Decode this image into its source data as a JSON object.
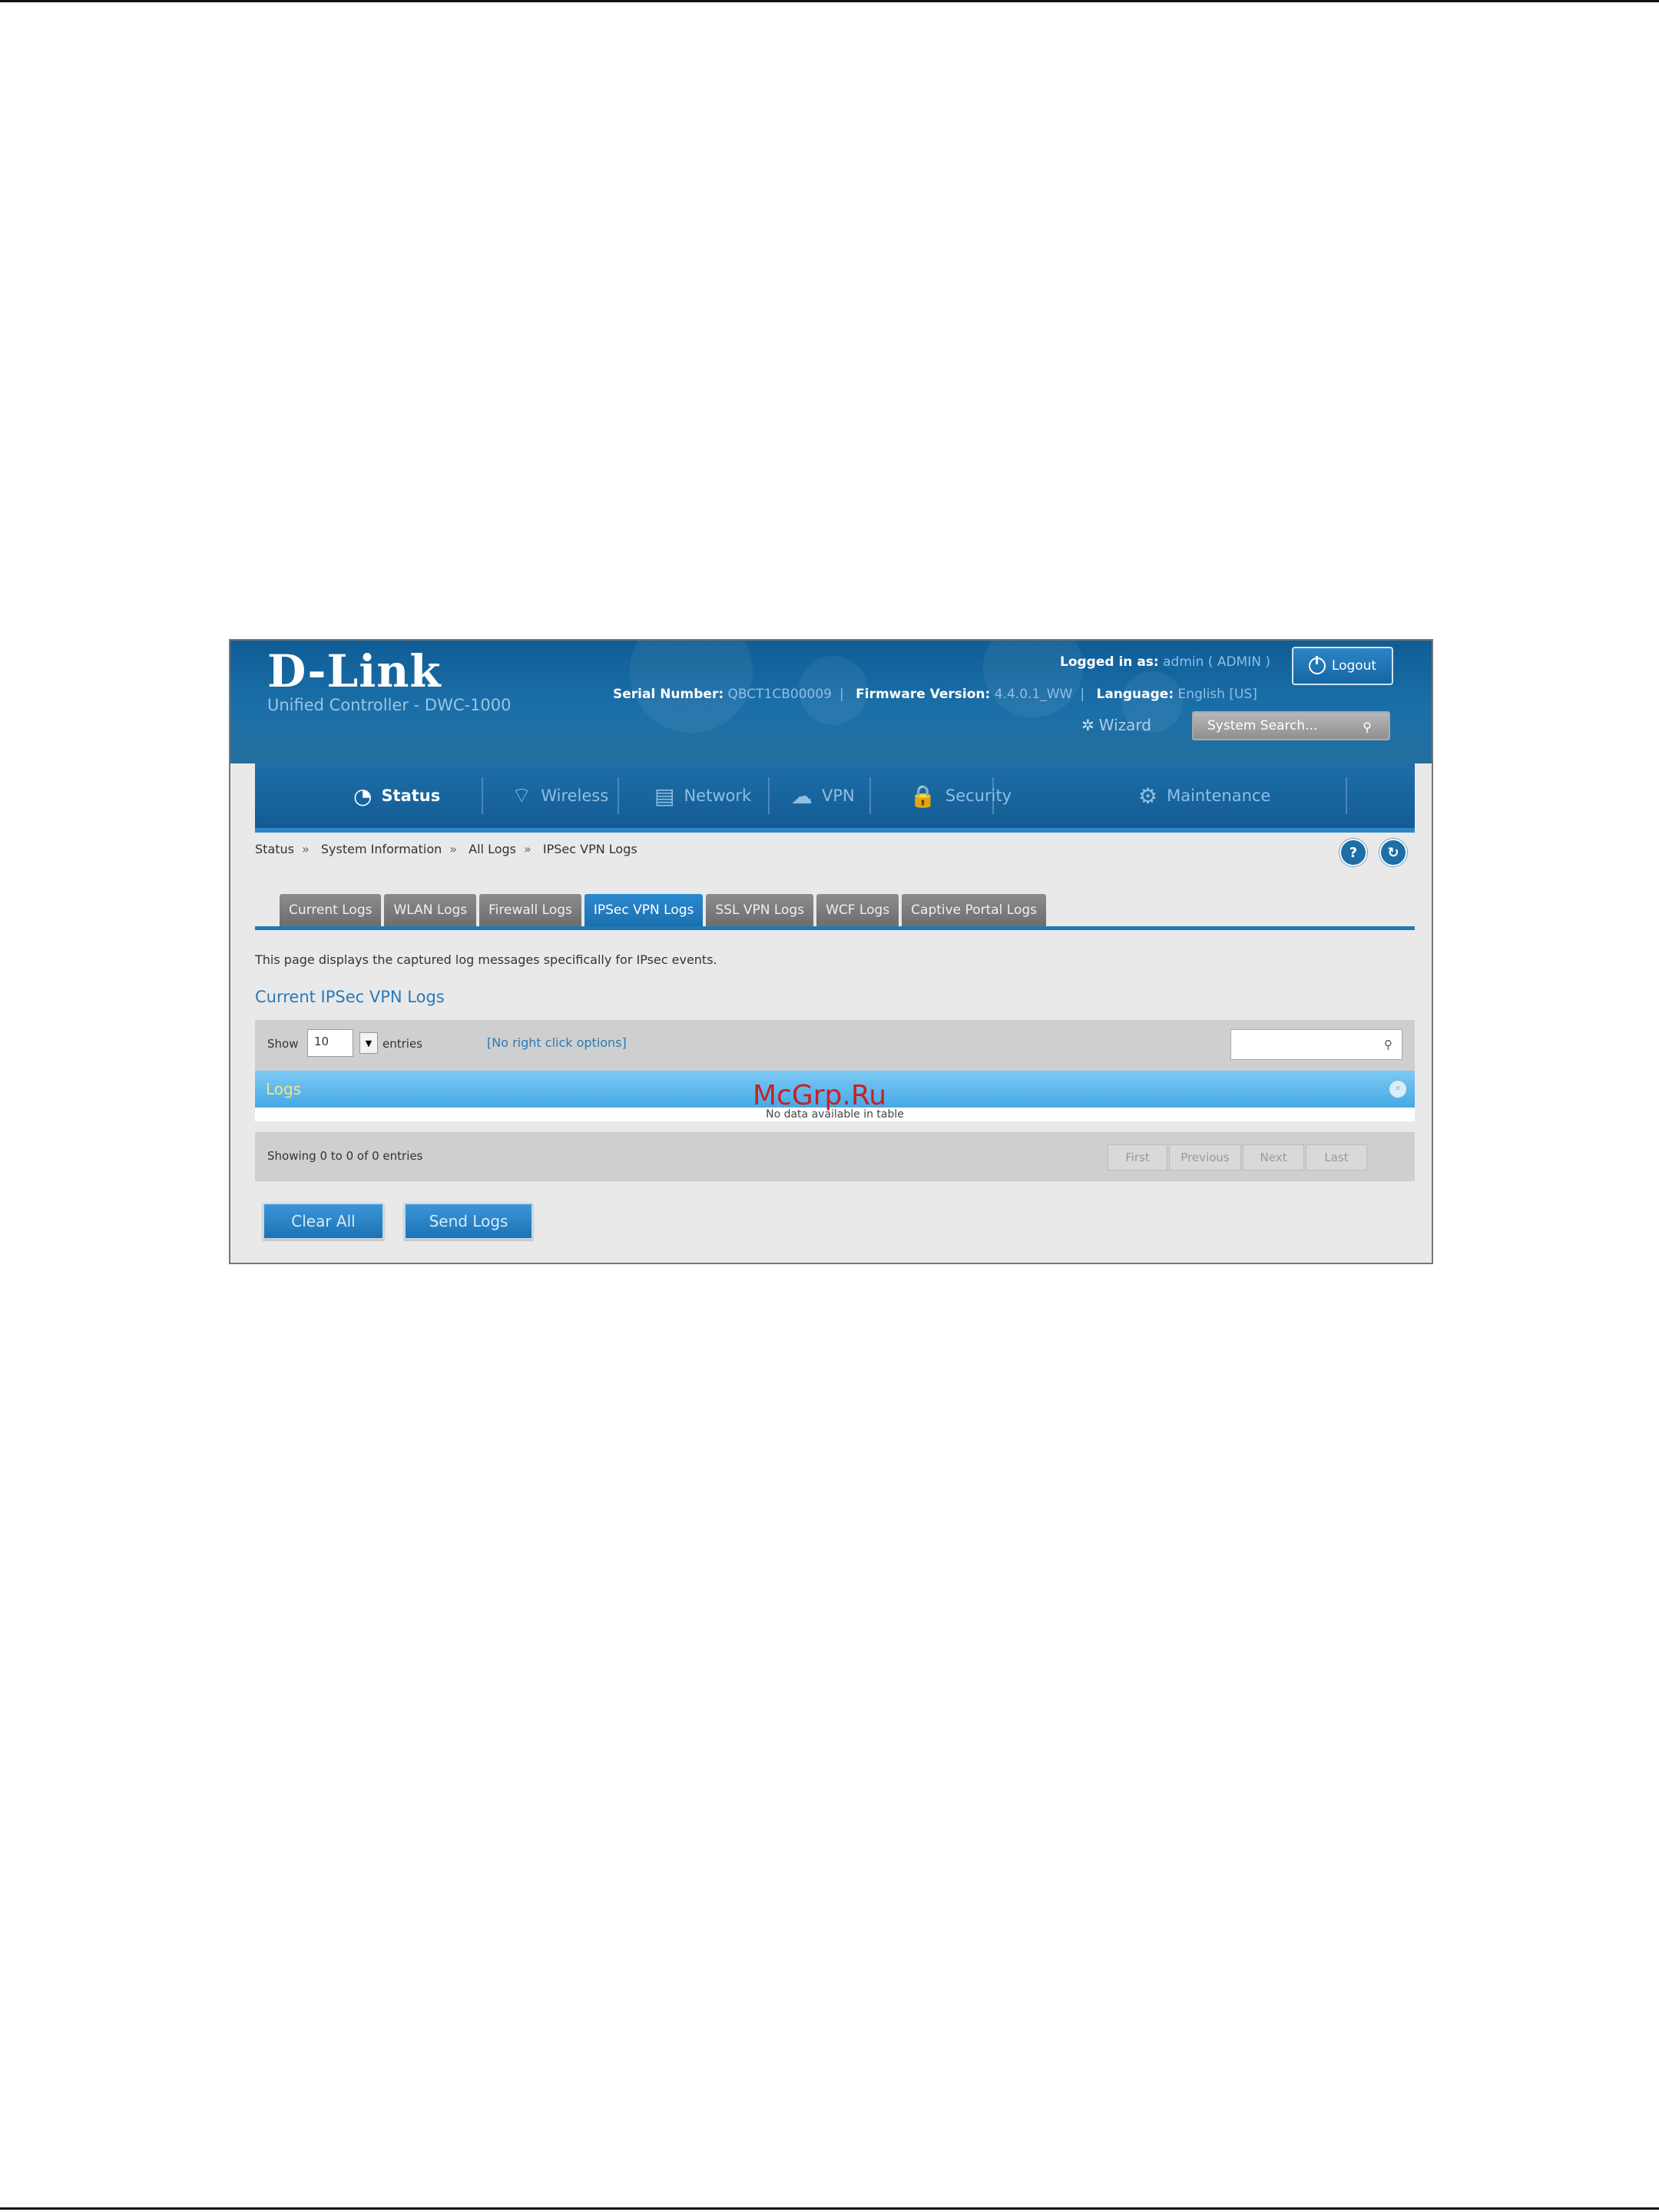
{
  "header": {
    "logo": "D-Link",
    "subtitle": "Unified Controller - DWC-1000",
    "logged_in_label": "Logged in as:",
    "logged_in_value": "admin ( ADMIN )",
    "logout_label": "Logout",
    "serial_label": "Serial Number:",
    "serial_value": "QBCT1CB00009",
    "firmware_label": "Firmware Version:",
    "firmware_value": "4.4.0.1_WW",
    "language_label": "Language:",
    "language_value": "English [US]",
    "wizard_label": "Wizard",
    "search_placeholder": "System Search..."
  },
  "nav": {
    "items": [
      {
        "label": "Status",
        "icon": "gauge-icon",
        "active": true
      },
      {
        "label": "Wireless",
        "icon": "wifi-icon",
        "active": false
      },
      {
        "label": "Network",
        "icon": "network-icon",
        "active": false
      },
      {
        "label": "VPN",
        "icon": "cloud-icon",
        "active": false
      },
      {
        "label": "Security",
        "icon": "lock-icon",
        "active": false
      },
      {
        "label": "Maintenance",
        "icon": "gears-icon",
        "active": false
      }
    ]
  },
  "breadcrumb": [
    "Status",
    "System Information",
    "All Logs",
    "IPSec VPN Logs"
  ],
  "tabs": [
    {
      "label": "Current Logs",
      "active": false
    },
    {
      "label": "WLAN Logs",
      "active": false
    },
    {
      "label": "Firewall Logs",
      "active": false
    },
    {
      "label": "IPSec VPN Logs",
      "active": true
    },
    {
      "label": "SSL VPN Logs",
      "active": false
    },
    {
      "label": "WCF Logs",
      "active": false
    },
    {
      "label": "Captive Portal Logs",
      "active": false
    }
  ],
  "page": {
    "description": "This page displays the captured log messages specifically for IPsec events.",
    "section_title": "Current IPSec VPN Logs"
  },
  "table": {
    "show_label": "Show",
    "show_value": "10",
    "entries_label": "entries",
    "right_click_label": "[No right click options]",
    "header_title": "Logs",
    "empty_message": "No data available in table",
    "info": "Showing 0 to 0 of 0 entries",
    "pager": [
      "First",
      "Previous",
      "Next",
      "Last"
    ]
  },
  "buttons": {
    "clear_all": "Clear All",
    "send_logs": "Send Logs"
  },
  "watermark": "McGrp.Ru",
  "colors": {
    "brand_blue": "#1b6fa8",
    "active_tab": "#1c6fae",
    "logs_header": "#46a9e6",
    "watermark": "#cc1f1f"
  }
}
